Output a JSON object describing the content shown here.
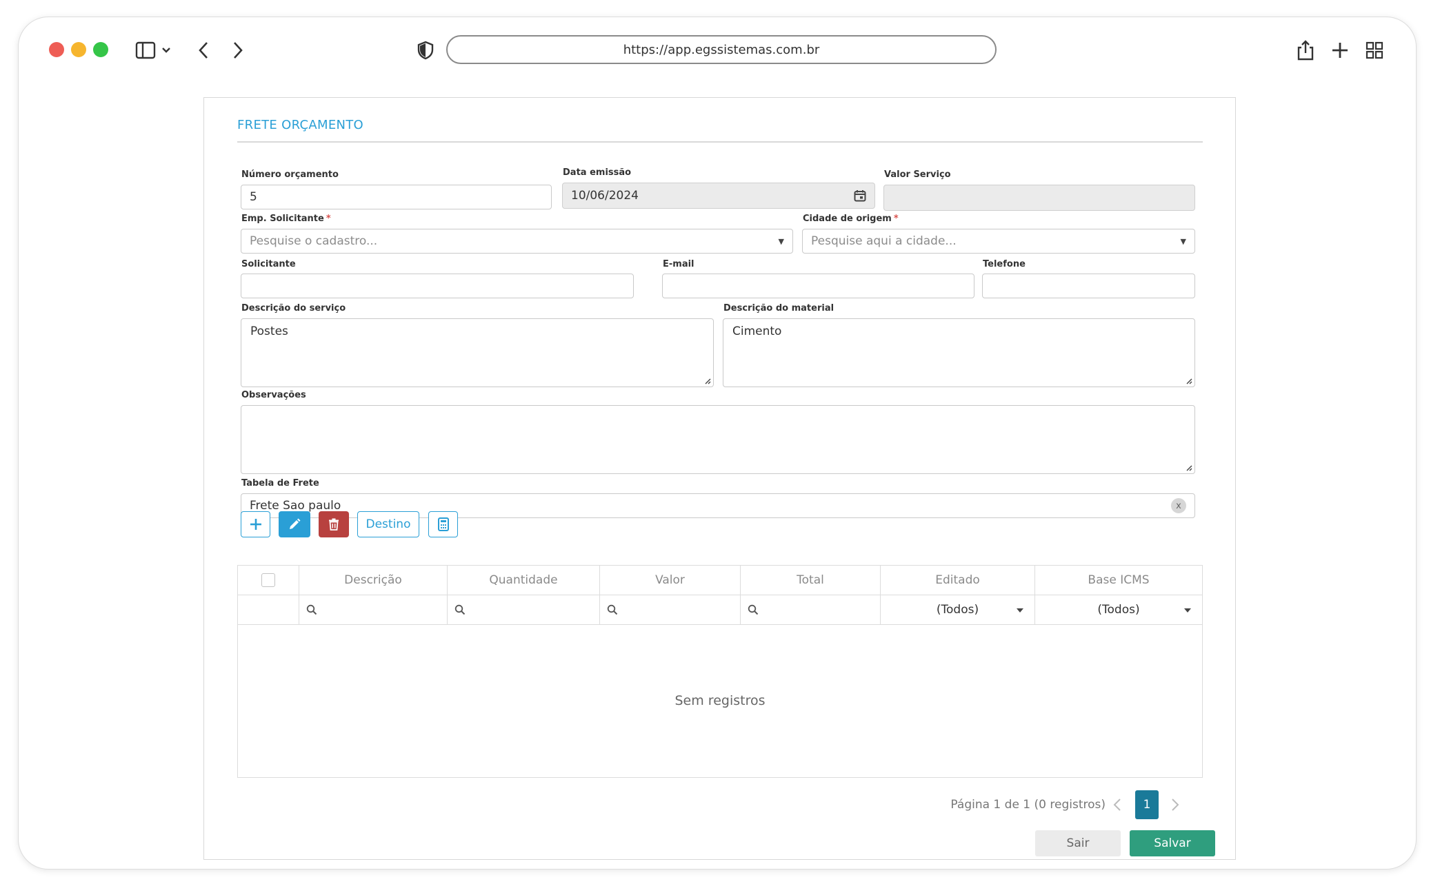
{
  "browser": {
    "url": "https://app.egssistemas.com.br",
    "traffic_colors": {
      "close": "#ee5d55",
      "minimize": "#f6b52e",
      "maximize": "#35c548"
    }
  },
  "form": {
    "title": "FRETE ORÇAMENTO",
    "numero_orcamento": {
      "label": "Número orçamento",
      "value": "5"
    },
    "data_emissao": {
      "label": "Data emissão",
      "value": "10/06/2024"
    },
    "valor_servico": {
      "label": "Valor Serviço",
      "value": ""
    },
    "emp_solicitante": {
      "label": "Emp. Solicitante",
      "required": "*",
      "placeholder": "Pesquise o cadastro..."
    },
    "cidade_origem": {
      "label": "Cidade de origem",
      "required": "*",
      "placeholder": "Pesquise aqui a cidade..."
    },
    "solicitante": {
      "label": "Solicitante",
      "value": ""
    },
    "email": {
      "label": "E-mail",
      "value": ""
    },
    "telefone": {
      "label": "Telefone",
      "value": ""
    },
    "descricao_servico": {
      "label": "Descrição do serviço",
      "value": "Postes"
    },
    "descricao_material": {
      "label": "Descrição do material",
      "value": "Cimento"
    },
    "observacoes": {
      "label": "Observações",
      "value": ""
    },
    "tabela_frete": {
      "label": "Tabela de Frete",
      "value": "Frete Sao paulo",
      "clear_glyph": "x"
    }
  },
  "toolbar": {
    "add_icon": "plus-icon",
    "edit_icon": "pencil-icon",
    "delete_icon": "trash-icon",
    "destino_label": "Destino",
    "calc_icon": "calculator-icon",
    "colors": {
      "primary": "#2a9fd6",
      "danger": "#b8413f"
    }
  },
  "grid": {
    "columns": [
      "Descrição",
      "Quantidade",
      "Valor",
      "Total",
      "Editado",
      "Base ICMS"
    ],
    "filter_editado": "(Todos)",
    "filter_base_icms": "(Todos)",
    "empty_text": "Sem registros"
  },
  "pager": {
    "info": "Página 1 de 1 (0 registros)",
    "current_page": "1"
  },
  "actions": {
    "sair": "Sair",
    "salvar": "Salvar",
    "salvar_color": "#2f9e7e"
  }
}
